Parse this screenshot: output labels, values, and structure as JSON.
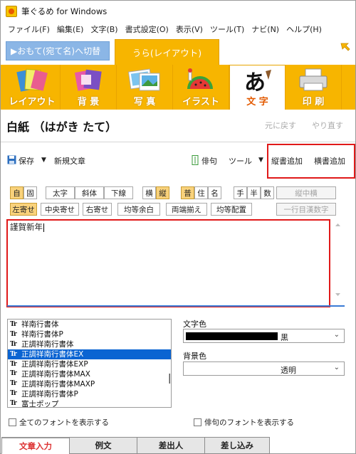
{
  "window": {
    "title": "筆ぐるめ for Windows"
  },
  "menubar": {
    "items": [
      "ファイル(F)",
      "編集(E)",
      "文字(B)",
      "書式設定(O)",
      "表示(V)",
      "ツール(T)",
      "ナビ(N)",
      "ヘルプ(H)"
    ]
  },
  "tabs": {
    "front": "▶おもて(宛て名)へ切替",
    "back": "うら(レイアウト)"
  },
  "ribbon": {
    "items": [
      "レイアウト",
      "背 景",
      "写 真",
      "イラスト",
      "文 字",
      "印 刷"
    ],
    "active": "文 字"
  },
  "header": {
    "title": "白紙 （はがき たて）",
    "undo": "元に戻す",
    "redo": "やり直す"
  },
  "toolbar": {
    "save": "保存",
    "new_text": "新規文章",
    "haiku": "俳句",
    "tools": "ツール",
    "add_vertical": "縦書追加",
    "add_horizontal": "横書追加"
  },
  "format": {
    "row1": {
      "auto": "自",
      "fixed": "固",
      "bold": "太字",
      "italic": "斜体",
      "underline": "下線",
      "horizontal": "横",
      "vertical": "縦",
      "normal": "普",
      "residence": "住",
      "name": "名",
      "hand": "手",
      "half": "半",
      "number": "数",
      "vertical_middle": "縦中横"
    },
    "row2": {
      "left": "左寄せ",
      "center": "中央寄せ",
      "right": "右寄せ",
      "equal_margin": "均等余白",
      "justify": "両端揃え",
      "equal_distribute": "均等配置",
      "one_line_kanji": "一行目漢数字"
    }
  },
  "editor": {
    "text": "謹賀新年"
  },
  "fonts": {
    "list": [
      "祥南行書体",
      "祥南行書体P",
      "正調祥南行書体",
      "正調祥南行書体EX",
      "正調祥南行書体EXP",
      "正調祥南行書体MAX",
      "正調祥南行書体MAXP",
      "正調祥南行書体P",
      "富士ポップ"
    ],
    "selected": "正調祥南行書体EX"
  },
  "props": {
    "text_color_label": "文字色",
    "text_color_value": "黒",
    "bg_color_label": "背景色",
    "bg_color_value": "透明"
  },
  "checkboxes": {
    "show_all_fonts": "全てのフォントを表示する",
    "show_haiku_fonts": "俳句のフォントを表示する"
  },
  "bottom_tabs": [
    "文章入力",
    "例文",
    "差出人",
    "差し込み"
  ],
  "colors": {
    "accent_orange": "#f7b500",
    "tab_blue": "#8bb6e6",
    "highlight_red": "#e01919",
    "selection_blue": "#0a64d2"
  }
}
